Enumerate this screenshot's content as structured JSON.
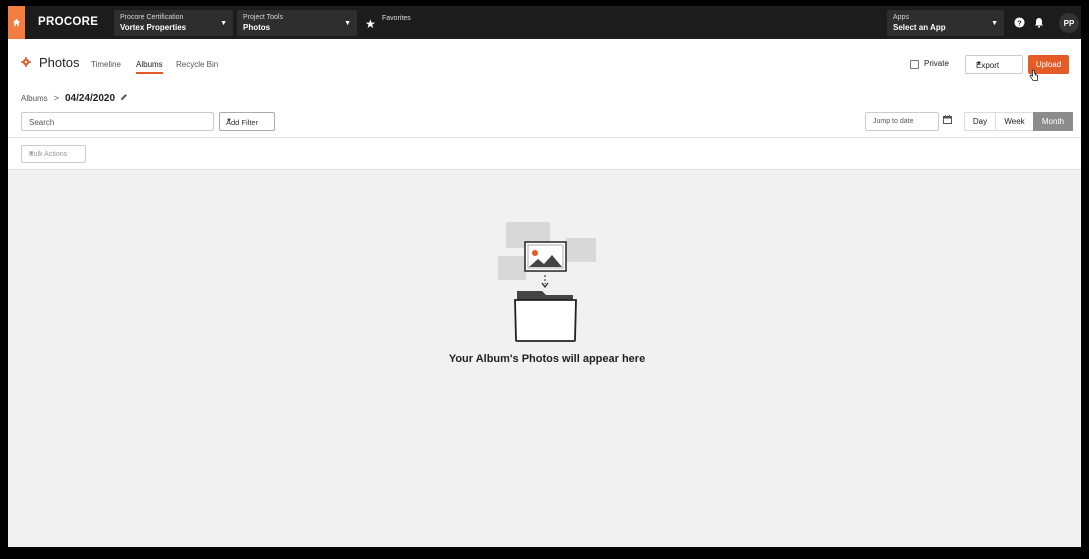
{
  "topnav": {
    "logo": "PROCORE",
    "project": {
      "small": "Procore Certification",
      "big": "Vortex Properties"
    },
    "tools": {
      "small": "Project Tools",
      "big": "Photos"
    },
    "favorites": "Favorites",
    "apps": {
      "small": "Apps",
      "big": "Select an App"
    },
    "avatar": "PP"
  },
  "header": {
    "title": "Photos",
    "tabs": [
      {
        "label": "Timeline",
        "active": false
      },
      {
        "label": "Albums",
        "active": true
      },
      {
        "label": "Recycle Bin",
        "active": false
      }
    ],
    "private_label": "Private",
    "export_label": "Export",
    "upload_label": "Upload"
  },
  "breadcrumb": {
    "parent": "Albums",
    "separator": ">",
    "current": "04/24/2020"
  },
  "filters": {
    "search_placeholder": "Search",
    "add_filter": "Add Filter",
    "jump_placeholder": "Jump to date",
    "views": [
      {
        "label": "Day",
        "active": false
      },
      {
        "label": "Week",
        "active": false
      },
      {
        "label": "Month",
        "active": true
      }
    ],
    "bulk_actions": "Bulk Actions"
  },
  "empty_state": {
    "message": "Your Album's Photos will appear here"
  },
  "colors": {
    "accent": "#e45b27",
    "home": "#f47e42",
    "nav_bg": "#1c1c1c",
    "content_bg": "#f1f1f1"
  }
}
